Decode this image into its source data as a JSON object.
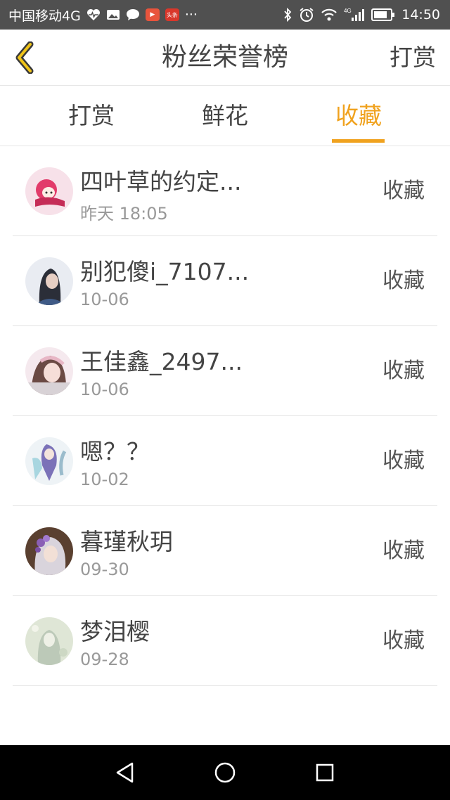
{
  "status_bar": {
    "carrier": "中国移动4G",
    "more": "···",
    "time": "14:50",
    "network_label": "4G",
    "icons": [
      "heart-rate-icon",
      "photo-icon",
      "chat-icon",
      "video-app-icon",
      "news-app-icon",
      "bluetooth-icon",
      "alarm-icon",
      "wifi-icon",
      "signal-icon",
      "battery-icon"
    ],
    "video_badge": "▶",
    "news_badge": "头条"
  },
  "header": {
    "title": "粉丝荣誉榜",
    "action": "打赏",
    "back_icon": "chevron-left-icon"
  },
  "tabs": [
    {
      "label": "打赏",
      "active": false
    },
    {
      "label": "鲜花",
      "active": false
    },
    {
      "label": "收藏",
      "active": true
    }
  ],
  "fans": [
    {
      "name": "四叶草的约定...",
      "date": "昨天 18:05",
      "action": "收藏"
    },
    {
      "name": "别犯傻i_7107...",
      "date": "10-06",
      "action": "收藏"
    },
    {
      "name": "王佳鑫_2497...",
      "date": "10-06",
      "action": "收藏"
    },
    {
      "name": "嗯？？",
      "date": "10-02",
      "action": "收藏"
    },
    {
      "name": "暮瑾秋玥",
      "date": "09-30",
      "action": "收藏"
    },
    {
      "name": "梦泪樱",
      "date": "09-28",
      "action": "收藏"
    }
  ],
  "colors": {
    "accent": "#f0a21e",
    "status_bar": "#505050",
    "nav_bar": "#000000",
    "text": "#444444",
    "subtext": "#999999"
  }
}
